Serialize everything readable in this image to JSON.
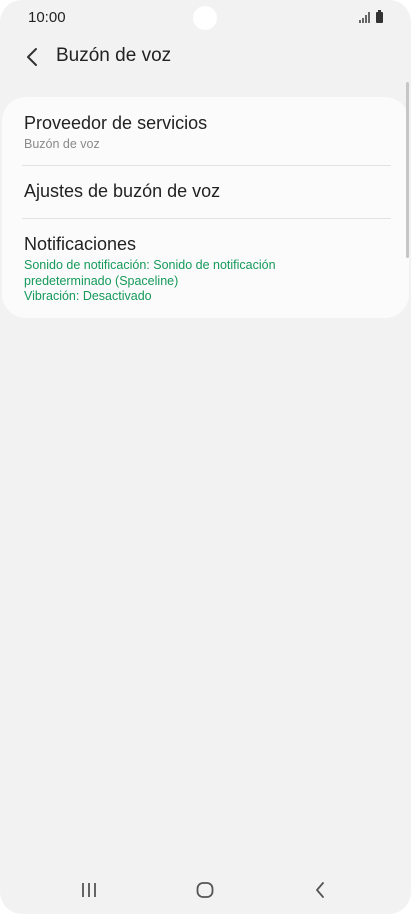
{
  "status_bar": {
    "time": "10:00"
  },
  "header": {
    "title": "Buzón de voz",
    "back_icon": "chevron-left-icon"
  },
  "settings": {
    "items": [
      {
        "title": "Proveedor de servicios",
        "subtitle": "Buzón de voz"
      },
      {
        "title": "Ajustes de buzón de voz"
      },
      {
        "title": "Notificaciones",
        "subtitle_lines": [
          "Sonido de notificación: Sonido de notificación predeterminado (Spaceline)",
          "Vibración: Desactivado"
        ]
      }
    ]
  },
  "nav_bar": {
    "icons": [
      "recents-icon",
      "home-icon",
      "back-icon"
    ]
  },
  "colors": {
    "background": "#f2f2f2",
    "card": "#fbfbfb",
    "accent_green": "#159a5b",
    "text_primary": "#222222",
    "text_secondary": "#8a8a8a"
  }
}
